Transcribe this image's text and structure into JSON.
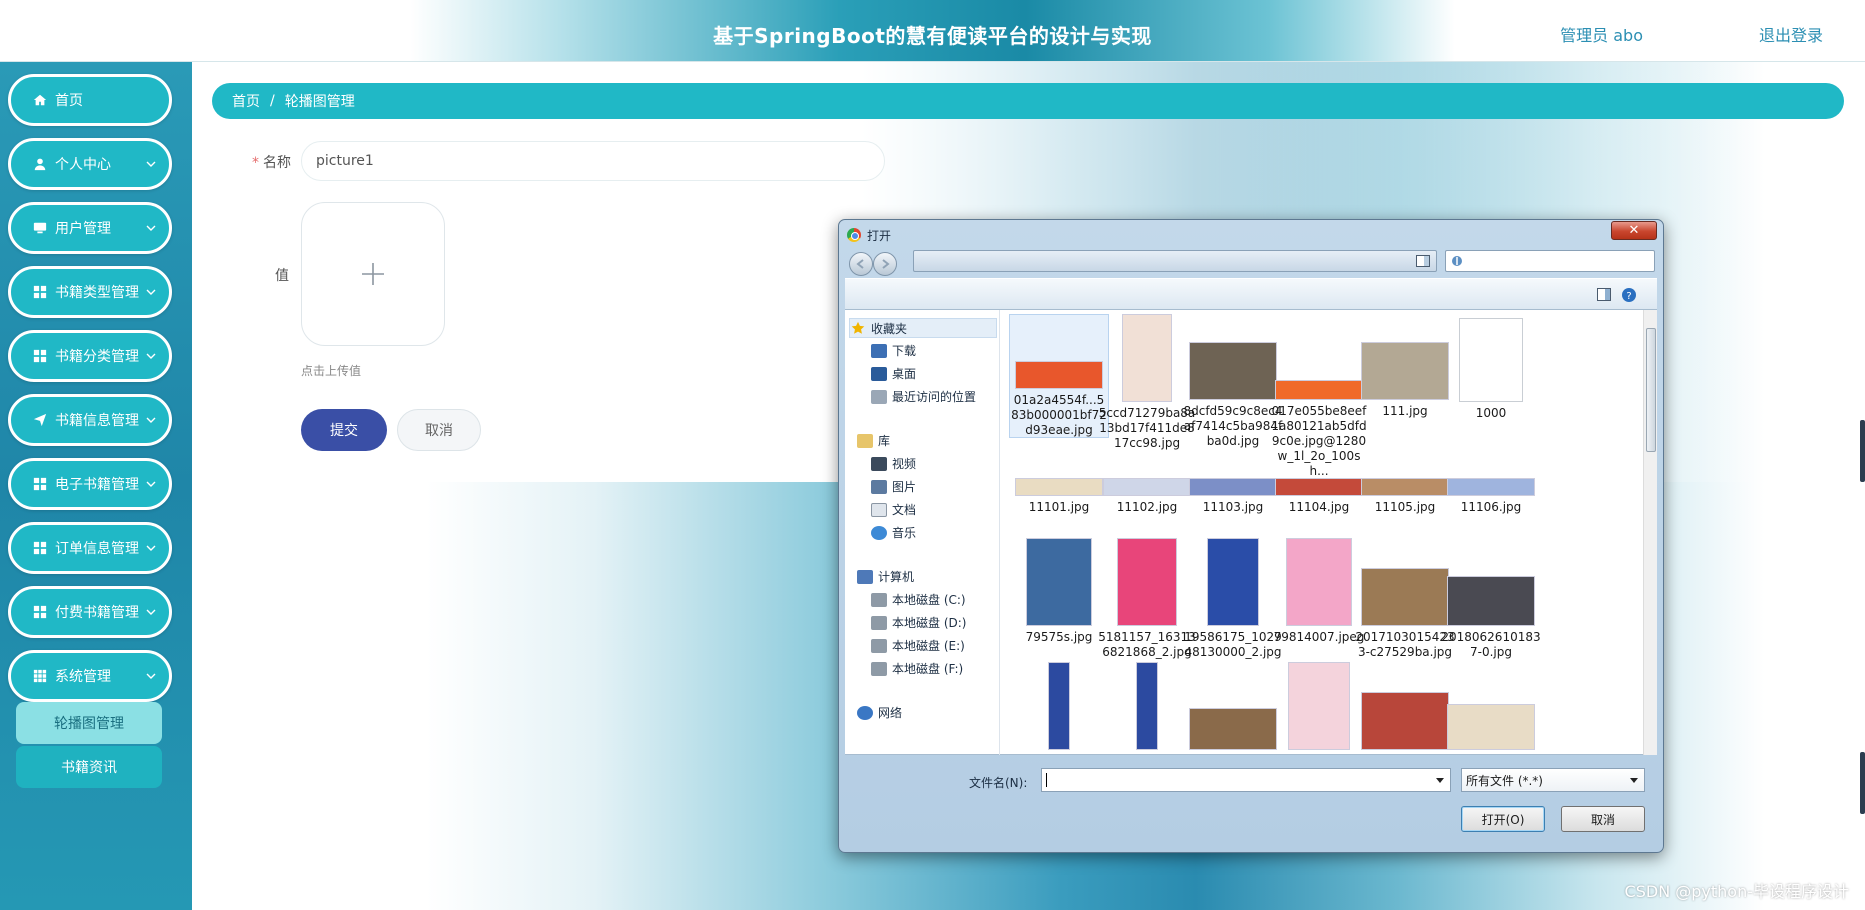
{
  "header": {
    "title": "基于SpringBoot的慧有便读平台的设计与实现",
    "user": "管理员 abo",
    "logout": "退出登录"
  },
  "sidebar": {
    "items": [
      {
        "label": "首页",
        "icon": "home-icon"
      },
      {
        "label": "个人中心",
        "icon": "user-icon"
      },
      {
        "label": "用户管理",
        "icon": "monitor-icon"
      },
      {
        "label": "书籍类型管理",
        "icon": "grid-icon"
      },
      {
        "label": "书籍分类管理",
        "icon": "grid-icon"
      },
      {
        "label": "书籍信息管理",
        "icon": "send-icon"
      },
      {
        "label": "电子书籍管理",
        "icon": "grid-icon"
      },
      {
        "label": "订单信息管理",
        "icon": "grid-icon"
      },
      {
        "label": "付费书籍管理",
        "icon": "grid-icon"
      },
      {
        "label": "系统管理",
        "icon": "apps-icon"
      }
    ],
    "submenu": [
      "轮播图管理",
      "书籍资讯"
    ]
  },
  "breadcrumb": {
    "home": "首页",
    "sep": "/",
    "current": "轮播图管理"
  },
  "form": {
    "name_label": "名称",
    "required_mark": "*",
    "name_value": "picture1",
    "value_label": "值",
    "upload_hint": "点击上传值",
    "submit": "提交",
    "cancel": "取消"
  },
  "dialog": {
    "title": "打开",
    "close": "✕",
    "nav": [
      {
        "label": "收藏夹",
        "icon": "star-icon"
      },
      {
        "label": "下载",
        "icon": "download-folder-icon"
      },
      {
        "label": "桌面",
        "icon": "desktop-icon"
      },
      {
        "label": "最近访问的位置",
        "icon": "recent-places-icon"
      },
      {
        "label": "库",
        "icon": "library-icon"
      },
      {
        "label": "视频",
        "icon": "video-icon"
      },
      {
        "label": "图片",
        "icon": "pictures-icon"
      },
      {
        "label": "文档",
        "icon": "documents-icon"
      },
      {
        "label": "音乐",
        "icon": "music-icon"
      },
      {
        "label": "计算机",
        "icon": "computer-icon"
      },
      {
        "label": "本地磁盘 (C:)",
        "icon": "disk-icon"
      },
      {
        "label": "本地磁盘 (D:)",
        "icon": "disk-icon"
      },
      {
        "label": "本地磁盘 (E:)",
        "icon": "disk-icon"
      },
      {
        "label": "本地磁盘 (F:)",
        "icon": "disk-icon"
      },
      {
        "label": "网络",
        "icon": "network-icon"
      }
    ],
    "files": [
      {
        "name": "01a2a4554f...583b000001bf72d93eae.jpg",
        "color": "#e8572c"
      },
      {
        "name": "5ccd71279ba8a13bd17f411de817cc98.jpg",
        "color": "#f1e0d6"
      },
      {
        "name": "8dcfd59c9c8ec4af7414c5ba984fba0d.jpg",
        "color": "#6e6354"
      },
      {
        "name": "017e055be8eef1a80121ab5dfd9c0e.jpg@1280w_1l_2o_100sh...",
        "color": "#f06a2a"
      },
      {
        "name": "111.jpg",
        "color": "#b3a894"
      },
      {
        "name": "1000",
        "color": "#ffffff"
      },
      {
        "name": "11101.jpg",
        "color": "#e9dcc2"
      },
      {
        "name": "11102.jpg",
        "color": "#cfd6e8"
      },
      {
        "name": "11103.jpg",
        "color": "#7c8fc7"
      },
      {
        "name": "11104.jpg",
        "color": "#c44a3a"
      },
      {
        "name": "11105.jpg",
        "color": "#b98d66"
      },
      {
        "name": "11106.jpg",
        "color": "#9fb4de"
      },
      {
        "name": "79575s.jpg",
        "color": "#3d6aa0"
      },
      {
        "name": "5181157_163136821868_2.jpg",
        "color": "#e8457a"
      },
      {
        "name": "19586175_102948130000_2.jpg",
        "color": "#2a4da8"
      },
      {
        "name": "79814007.jpeg",
        "color": "#f3a6c8"
      },
      {
        "name": "20171030154233-c27529ba.jpg",
        "color": "#9b7a55"
      },
      {
        "name": "20180626101837-0.jpg",
        "color": "#4a4a52"
      }
    ],
    "filename_label": "文件名(N):",
    "filename_value": "",
    "filetype": "所有文件 (*.*)",
    "open": "打开(O)",
    "cancel": "取消"
  },
  "watermark": "CSDN @python-毕设程序设计"
}
